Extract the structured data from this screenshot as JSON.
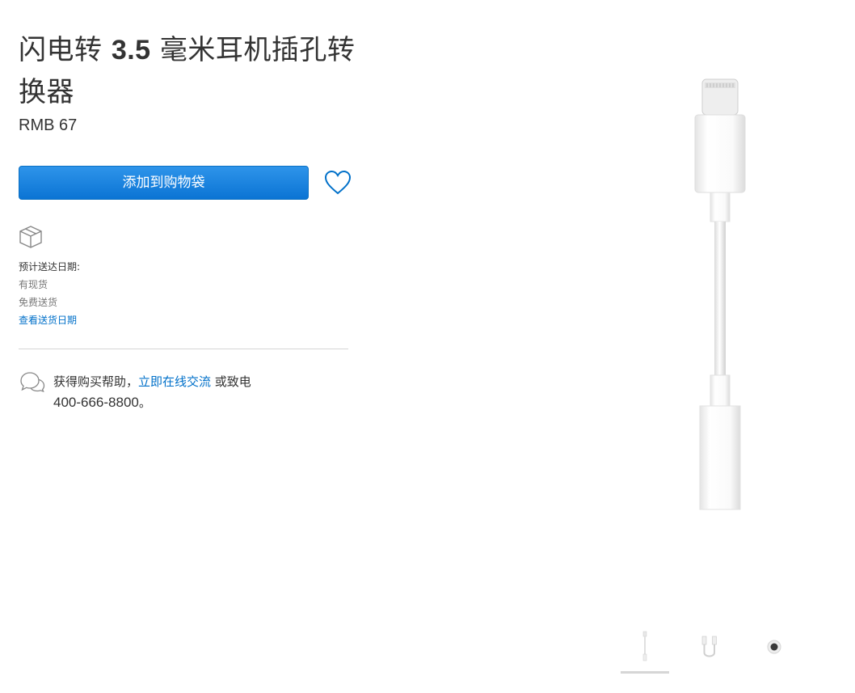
{
  "product": {
    "title_prefix": "闪电转 ",
    "title_number": "3.5",
    "title_suffix": " 毫米耳机插孔转换器",
    "price": "RMB 67"
  },
  "actions": {
    "add_to_bag_label": "添加到购物袋"
  },
  "delivery": {
    "title": "预计送达日期:",
    "availability": "有现货",
    "shipping": "免费送货",
    "link_label": "查看送货日期"
  },
  "help": {
    "prefix": "获得购买帮助，",
    "link_label": "立即在线交流",
    "middle": " 或致电",
    "phone": "400-666-8800",
    "suffix": "。"
  },
  "gallery": {
    "thumbnails": [
      "adapter-full",
      "adapter-curled",
      "jack-port"
    ],
    "selected_index": 0
  },
  "colors": {
    "accent": "#0070c9",
    "button_top": "#2e94ea",
    "button_bottom": "#0b74d4",
    "text": "#333333",
    "muted": "#777777",
    "divider": "#d6d6d6"
  }
}
